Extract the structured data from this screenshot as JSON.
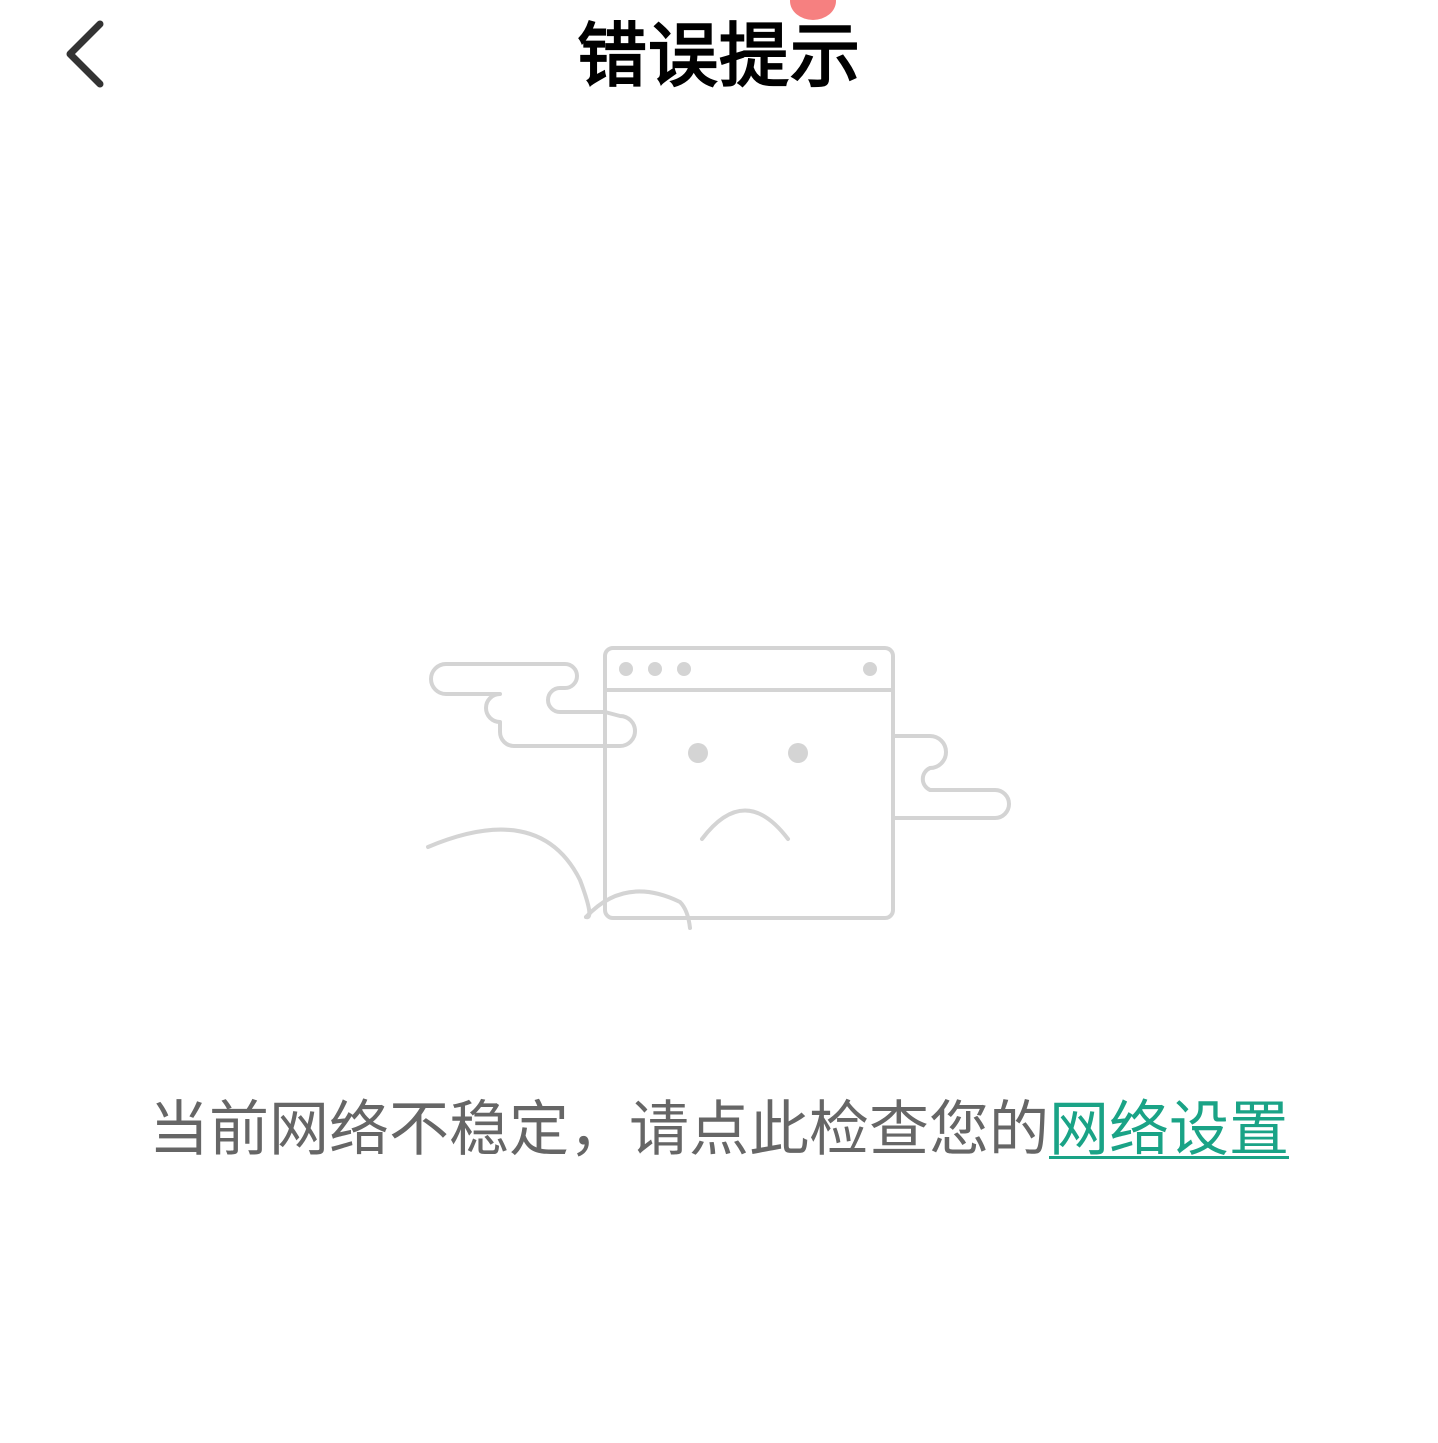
{
  "header": {
    "title": "错误提示",
    "back_icon": "chevron-left-icon"
  },
  "error": {
    "illustration_icon": "sad-browser-window-icon",
    "message": "当前网络不稳定，请点此检查您的",
    "link_label": "网络设置"
  },
  "colors": {
    "title": "#000000",
    "message": "#666666",
    "link": "#1aa386",
    "illustration_stroke": "#d4d4d4",
    "status_dot": "#f46a6a"
  }
}
